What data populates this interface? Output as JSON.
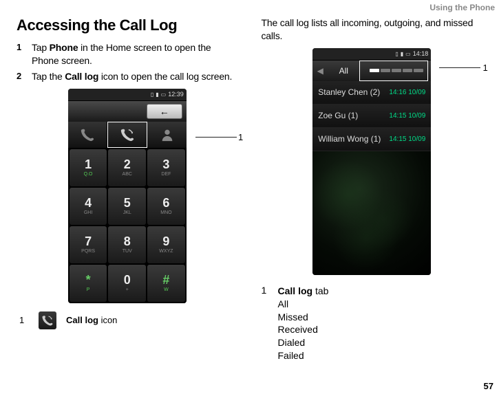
{
  "header": {
    "section": "Using the Phone"
  },
  "left": {
    "title": "Accessing the Call Log",
    "steps": [
      {
        "num": "1",
        "pre": "Tap ",
        "bold": "Phone",
        "post": " in the Home screen to open the Phone screen."
      },
      {
        "num": "2",
        "pre": "Tap the ",
        "bold": "Call log",
        "post": " icon to open the call log screen."
      }
    ],
    "phone": {
      "clock": "12:39",
      "keypad": [
        {
          "digit": "1",
          "sub": "Q.O"
        },
        {
          "digit": "2",
          "sub": "ABC"
        },
        {
          "digit": "3",
          "sub": "DEF"
        },
        {
          "digit": "4",
          "sub": "GHI"
        },
        {
          "digit": "5",
          "sub": "JKL"
        },
        {
          "digit": "6",
          "sub": "MNO"
        },
        {
          "digit": "7",
          "sub": "PQRS"
        },
        {
          "digit": "8",
          "sub": "TUV"
        },
        {
          "digit": "9",
          "sub": "WXYZ"
        },
        {
          "digit": "*",
          "sub": "P"
        },
        {
          "digit": "0",
          "sub": "+"
        },
        {
          "digit": "#",
          "sub": "W"
        }
      ]
    },
    "callout": "1",
    "legend": {
      "num": "1",
      "label_bold": "Call log",
      "label_post": " icon"
    }
  },
  "right": {
    "intro": "The call log lists all incoming, outgoing, and missed calls.",
    "phone": {
      "clock": "14:18",
      "tab_label": "All",
      "entries": [
        {
          "name": "Stanley Chen (2)",
          "time": "14:16 10/09"
        },
        {
          "name": "Zoe Gu (1)",
          "time": "14:15 10/09"
        },
        {
          "name": "William Wong (1)",
          "time": "14:15 10/09"
        }
      ]
    },
    "callout": "1",
    "legend": {
      "num": "1",
      "title_bold": "Call log",
      "title_post": " tab",
      "items": [
        "All",
        "Missed",
        "Received",
        "Dialed",
        "Failed"
      ]
    }
  },
  "page_number": "57"
}
